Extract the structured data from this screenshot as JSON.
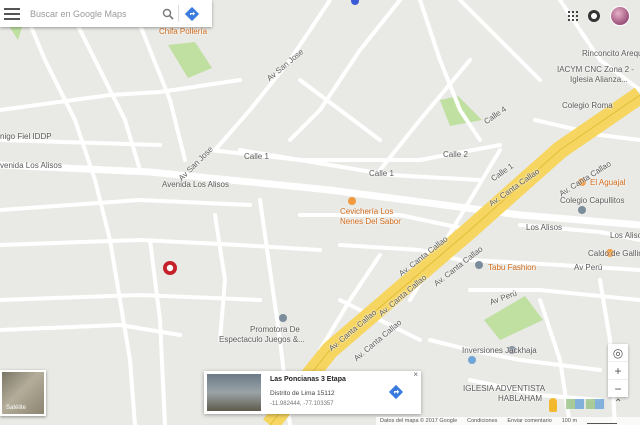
{
  "search": {
    "placeholder": "Buscar en Google Maps"
  },
  "map_labels": {
    "chifa_polleria": "Chifa Pollería",
    "av_san_jose_1": "Av San Jose",
    "av_san_jose_2": "Av San Jose",
    "rinconcito": "Rinconcito Arequ",
    "iacym": "IACYM CNC Zona 2 -",
    "iglesia_alianza": "Iglesia Alianza...",
    "colegio_roma": "Colegio Roma",
    "calle4": "Calle 4",
    "nigo_fiel": "nigo Fiel IDDP",
    "calle1a": "Calle 1",
    "calle2": "Calle 2",
    "calle1b": "Calle 1",
    "calle1c": "Calle 1",
    "avenida_alisos_left": "venida Los Alisos",
    "avenida_alisos": "Avenida Los Alisos",
    "el_aguajal": "El Aguajal",
    "colegio_capullitos": "Colegio Capullitos",
    "cevicheria_1": "Cevichería Los",
    "cevicheria_2": "Nenes Del Sabor",
    "los_alisos_1": "Los Alisos",
    "los_alisos_2": "Los Aliso",
    "caldo_gallina": "Caldo de Gallin",
    "av_canta_callao_1": "Av. Canta Callao",
    "av_canta_callao_2": "Av. Canta Callao",
    "av_canta_callao_3": "Av. Canta Callao",
    "av_canta_callao_4": "Av. Canta Callao",
    "av_canta_callao_5": "Av. Canta Callao",
    "av_canta_callao_6": "Av. Canta Callao",
    "av_canta_callao_7": "Av. Canta Callao",
    "tabu_fashion": "Tabu Fashion",
    "av_peru_1": "Av Perú",
    "av_peru_2": "Av Perú",
    "promotora_1": "Promotora De",
    "promotora_2": "Espectaculo Juegos &...",
    "inversiones": "Inversiones Jackhaja",
    "iglesia_adventista_1": "IGLESIA ADVENTISTA",
    "iglesia_adventista_2": "HABLAHAM"
  },
  "satellite": {
    "label": "Satélite"
  },
  "place": {
    "title": "Las Poncianas 3 Etapa",
    "subtitle": "Distrito de Lima 15112",
    "coords": "-11.982444, -77.103357"
  },
  "footer": {
    "data": "Datos del mapa © 2017 Google",
    "terms": "Condiciones",
    "feedback": "Enviar comentario",
    "scale": "100 m"
  },
  "colors": {
    "major_road": "#f6d660",
    "park": "#bfe0a0",
    "land": "#e9e9e5"
  }
}
